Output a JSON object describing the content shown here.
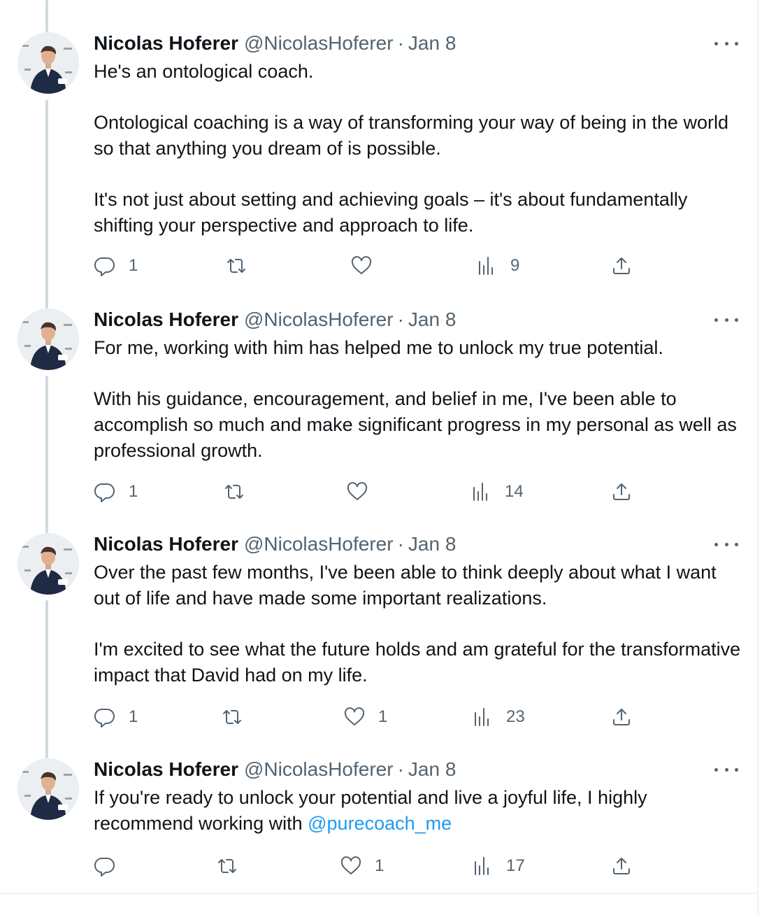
{
  "author": {
    "name": "Nicolas Hoferer",
    "handle": "@NicolasHoferer",
    "separator": "·"
  },
  "icons": {
    "reply": "reply-icon",
    "retweet": "retweet-icon",
    "like": "heart-icon",
    "views": "views-bar-chart-icon",
    "share": "share-upload-icon",
    "more": "more-dots-icon"
  },
  "tweets": [
    {
      "date": "Jan 8",
      "paragraphs": [
        "He's an ontological coach.",
        "Ontological coaching is a way of transforming your way of being in the world so that anything you dream of is possible.",
        "It's not just about setting and achieving goals – it's about fundamentally shifting your perspective and approach to life."
      ],
      "replies": "1",
      "retweets": "",
      "likes": "",
      "views": "9"
    },
    {
      "date": "Jan 8",
      "paragraphs": [
        "For me, working with him has helped me to unlock my true potential.",
        "With his guidance, encouragement, and belief in me, I've been able to accomplish so much and make significant progress in my personal as well as professional growth."
      ],
      "replies": "1",
      "retweets": "",
      "likes": "",
      "views": "14"
    },
    {
      "date": "Jan 8",
      "paragraphs": [
        "Over the past few months, I've been able to think deeply about what I want out of life and have made some important realizations.",
        "I'm excited to see what the future holds and am grateful for the transformative impact that David had on my life."
      ],
      "replies": "1",
      "retweets": "",
      "likes": "1",
      "views": "23"
    },
    {
      "date": "Jan 8",
      "text_before_mention": "If you're ready to unlock your potential and live a joyful life, I highly recommend working with ",
      "mention": "@purecoach_me",
      "replies": "",
      "retweets": "",
      "likes": "1",
      "views": "17"
    }
  ]
}
